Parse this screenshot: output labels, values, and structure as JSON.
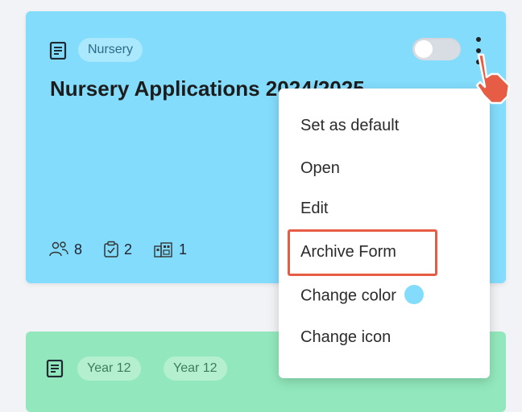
{
  "cards": [
    {
      "tag": "Nursery",
      "title": "Nursery Applications 2024/2025",
      "color": "#83dcfb",
      "stats": {
        "people": "8",
        "clipboard": "2",
        "buildings": "1"
      },
      "toggle_on": false
    },
    {
      "tags": [
        "Year 12",
        "Year 12"
      ],
      "color": "#92e8bc"
    }
  ],
  "menu": {
    "items": [
      {
        "label": "Set as default"
      },
      {
        "label": "Open"
      },
      {
        "label": "Edit"
      },
      {
        "label": "Archive Form",
        "highlighted": true
      },
      {
        "label": "Change color",
        "swatch": "#83dcfb"
      },
      {
        "label": "Change icon"
      }
    ]
  },
  "icons": {
    "form": "document-icon",
    "more": "kebab-menu-icon",
    "members": "people-icon",
    "submissions": "clipboard-icon",
    "locations": "buildings-icon"
  },
  "colors": {
    "highlight": "#e75c45"
  }
}
